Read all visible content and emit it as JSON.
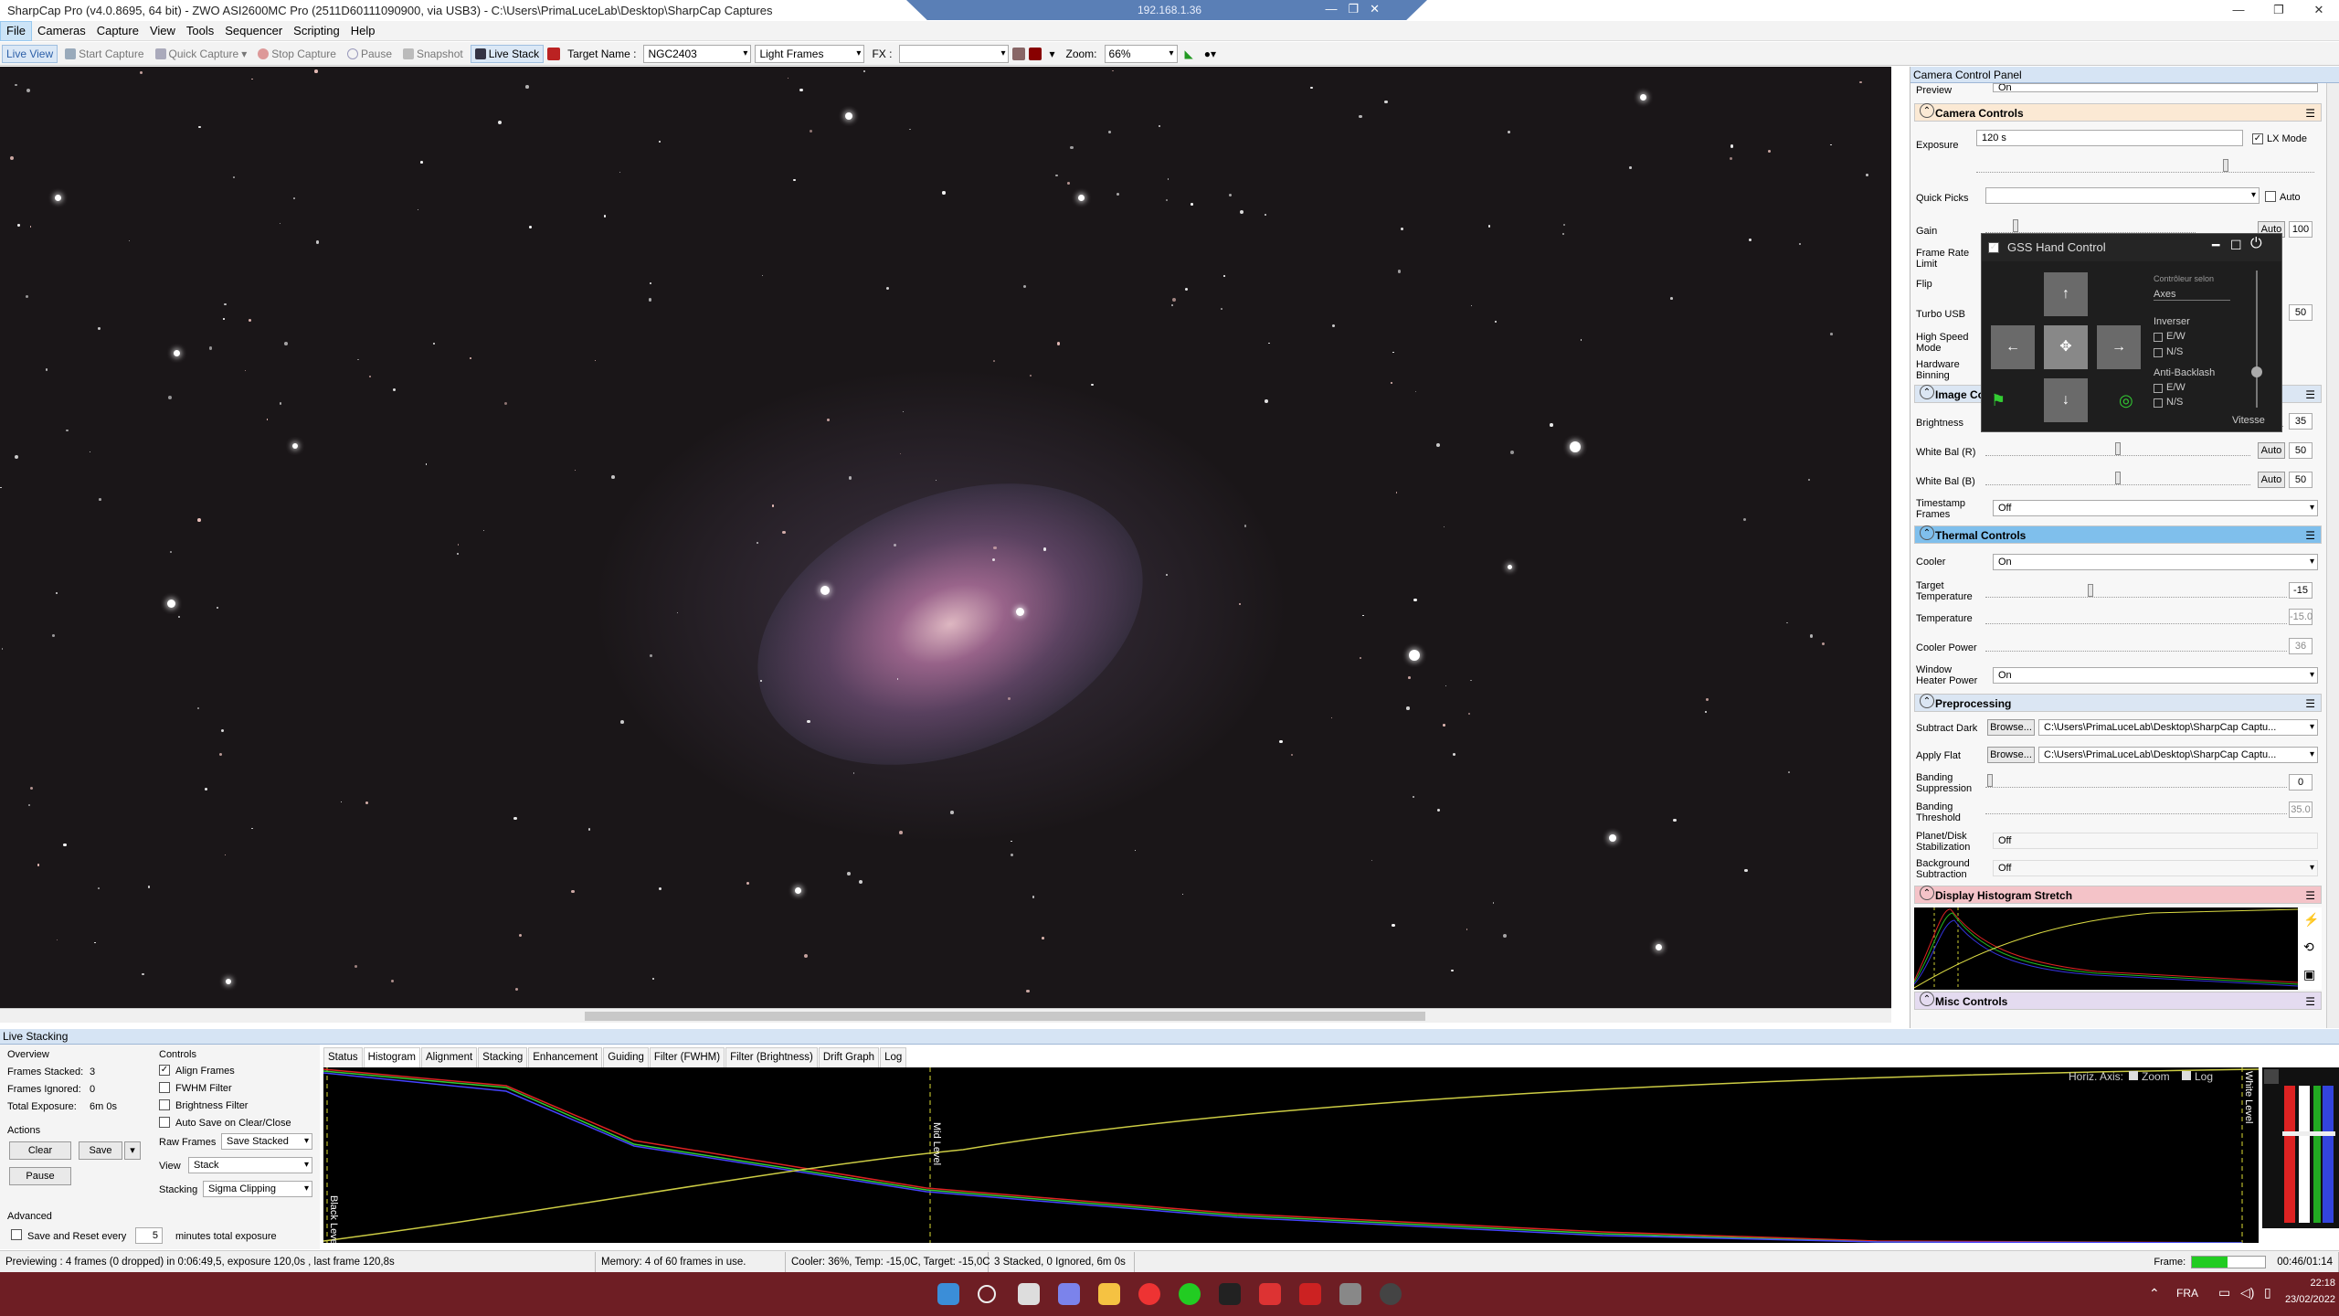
{
  "window": {
    "title": "SharpCap Pro (v4.0.8695, 64 bit) - ZWO ASI2600MC Pro (2511D60111090900, via USB3) - C:\\Users\\PrimaLuceLab\\Desktop\\SharpCap Captures",
    "remote_ip": "192.168.1.36"
  },
  "menu": [
    "File",
    "Cameras",
    "Capture",
    "View",
    "Tools",
    "Sequencer",
    "Scripting",
    "Help"
  ],
  "toolbar": {
    "live_view": "Live View",
    "start_capture": "Start Capture",
    "quick_capture": "Quick Capture",
    "stop_capture": "Stop Capture",
    "pause": "Pause",
    "snapshot": "Snapshot",
    "live_stack": "Live Stack",
    "target_label": "Target Name :",
    "target_value": "NGC2403",
    "frame_type": "Light Frames",
    "fx_label": "FX :",
    "fx_value": "",
    "zoom_label": "Zoom:",
    "zoom_value": "66%"
  },
  "panel": {
    "title": "Camera Control Panel",
    "preview_label": "Preview",
    "preview_value": "On",
    "camera_controls": "Camera Controls",
    "exposure_label": "Exposure",
    "exposure_value": "120 s",
    "lx_mode": "LX Mode",
    "quick_picks_label": "Quick Picks",
    "auto_label": "Auto",
    "gain_label": "Gain",
    "gain_auto": "Auto",
    "gain_value": "100",
    "frame_rate_label": "Frame Rate Limit",
    "flip_label": "Flip",
    "turbo_usb_label": "Turbo USB",
    "turbo_usb_value": "50",
    "high_speed_label": "High Speed Mode",
    "hw_binning_label": "Hardware Binning",
    "image_controls": "Image Controls",
    "brightness_label": "Brightness",
    "brightness_value": "35",
    "wb_r_label": "White Bal (R)",
    "wb_r_auto": "Auto",
    "wb_r_value": "50",
    "wb_b_label": "White Bal (B)",
    "wb_b_auto": "Auto",
    "wb_b_value": "50",
    "timestamp_label": "Timestamp Frames",
    "timestamp_value": "Off",
    "thermal_controls": "Thermal Controls",
    "cooler_label": "Cooler",
    "cooler_value": "On",
    "target_temp_label": "Target Temperature",
    "target_temp_value": "-15",
    "temperature_label": "Temperature",
    "temperature_value": "-15.0",
    "cooler_power_label": "Cooler Power",
    "cooler_power_value": "36",
    "window_heater_label": "Window Heater Power",
    "window_heater_value": "On",
    "preprocessing": "Preprocessing",
    "subtract_dark_label": "Subtract Dark",
    "browse": "Browse...",
    "subtract_dark_path": "C:\\Users\\PrimaLuceLab\\Desktop\\SharpCap Captu...",
    "apply_flat_label": "Apply Flat",
    "apply_flat_path": "C:\\Users\\PrimaLuceLab\\Desktop\\SharpCap Captu...",
    "banding_supp_label": "Banding Suppression",
    "banding_supp_value": "0",
    "banding_thr_label": "Banding Threshold",
    "banding_thr_value": "35.0",
    "planet_stab_label": "Planet/Disk Stabilization",
    "planet_stab_value": "Off",
    "bg_sub_label": "Background Subtraction",
    "bg_sub_value": "Off",
    "histogram_stretch": "Display Histogram Stretch",
    "misc_controls": "Misc Controls"
  },
  "gss": {
    "title": "GSS Hand Control",
    "controller_label": "Contrôleur selon",
    "controller_value": "Axes",
    "inverser": "Inverser",
    "ew": "E/W",
    "ns": "N/S",
    "anti_backlash": "Anti-Backlash",
    "vitesse": "Vitesse"
  },
  "live_stacking": {
    "title": "Live Stacking",
    "overview": "Overview",
    "frames_stacked_label": "Frames Stacked:",
    "frames_stacked": "3",
    "frames_ignored_label": "Frames Ignored:",
    "frames_ignored": "0",
    "total_exposure_label": "Total Exposure:",
    "total_exposure": "6m 0s",
    "actions": "Actions",
    "clear": "Clear",
    "save": "Save",
    "pause": "Pause",
    "advanced": "Advanced",
    "save_reset": "Save and Reset every",
    "save_reset_value": "5",
    "minutes": "minutes total exposure",
    "controls": "Controls",
    "align_frames": "Align Frames",
    "fwhm_filter": "FWHM Filter",
    "brightness_filter": "Brightness Filter",
    "auto_save": "Auto Save on Clear/Close",
    "raw_frames_label": "Raw Frames",
    "raw_frames_value": "Save Stacked",
    "view_label": "View",
    "view_value": "Stack",
    "stacking_label": "Stacking",
    "stacking_value": "Sigma Clipping",
    "tabs": [
      "Status",
      "Histogram",
      "Alignment",
      "Stacking",
      "Enhancement",
      "Guiding",
      "Filter (FWHM)",
      "Filter (Brightness)",
      "Drift Graph",
      "Log"
    ],
    "horiz_axis": "Horiz. Axis:",
    "zoom": "Zoom",
    "log": "Log",
    "black_level": "Black Level",
    "mid_level": "Mid Level",
    "white_level": "White Level"
  },
  "status": {
    "previewing": "Previewing : 4 frames (0 dropped) in 0:06:49,5, exposure 120,0s , last frame 120,8s",
    "memory": "Memory: 4 of 60 frames in use.",
    "cooler": "Cooler: 36%, Temp: -15,0C, Target: -15,0C",
    "stacked": "3 Stacked, 0 Ignored, 6m 0s",
    "frame_label": "Frame:",
    "frame_time": "00:46/01:14"
  },
  "taskbar": {
    "lang": "FRA",
    "time": "22:18",
    "date": "23/02/2022"
  }
}
